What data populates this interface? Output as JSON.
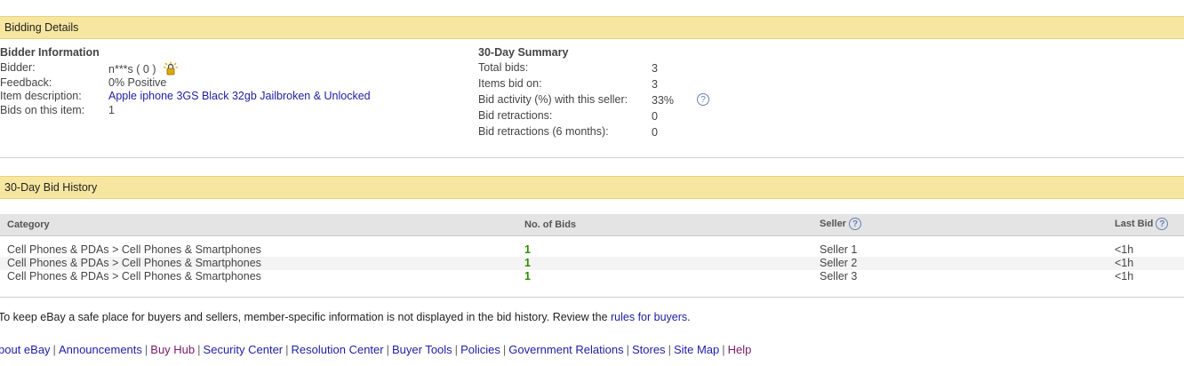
{
  "bidding_details": {
    "header": "Bidding Details",
    "bidder_info": {
      "title": "Bidder Information",
      "bidder_label": "Bidder:",
      "bidder_value": "n***s ( 0 )",
      "feedback_label": "Feedback:",
      "feedback_value": "0% Positive",
      "item_label": "Item description:",
      "item_value": "Apple iphone 3GS Black 32gb Jailbroken & Unlocked",
      "bids_label": "Bids on this item:",
      "bids_value": "1"
    },
    "summary": {
      "title": "30-Day Summary",
      "rows": [
        {
          "label": "Total bids:",
          "value": "3"
        },
        {
          "label": "Items bid on:",
          "value": "3"
        },
        {
          "label": "Bid activity (%) with this seller:",
          "value": "33%"
        },
        {
          "label": "Bid retractions:",
          "value": "0"
        },
        {
          "label": "Bid retractions (6 months):",
          "value": "0"
        }
      ],
      "help_glyph": "?"
    }
  },
  "history": {
    "header": "30-Day Bid History",
    "columns": {
      "category": "Category",
      "bids": "No. of Bids",
      "seller": "Seller",
      "last_bid": "Last Bid"
    },
    "help_glyph": "?",
    "rows": [
      {
        "category": "Cell Phones & PDAs > Cell Phones & Smartphones",
        "bids": "1",
        "seller": "Seller 1",
        "last_bid": "<1h"
      },
      {
        "category": "Cell Phones & PDAs > Cell Phones & Smartphones",
        "bids": "1",
        "seller": "Seller 2",
        "last_bid": "<1h"
      },
      {
        "category": "Cell Phones & PDAs > Cell Phones & Smartphones",
        "bids": "1",
        "seller": "Seller 3",
        "last_bid": "<1h"
      }
    ]
  },
  "notice": {
    "text": "To keep eBay a safe place for buyers and sellers, member-specific information is not displayed in the bid history. Review the",
    "link": "rules for buyers",
    "end": "."
  },
  "footer": {
    "links": [
      "bout eBay",
      "Announcements",
      "Buy Hub",
      "Security Center",
      "Resolution Center",
      "Buyer Tools",
      "Policies",
      "Government Relations",
      "Stores",
      "Site Map",
      "Help"
    ],
    "separator": "|"
  },
  "colors": {
    "header_bar": "#f7e6a0",
    "link": "#1e1ea0",
    "bids_green": "#2e8b00",
    "visited_link": "#7a1a6a"
  }
}
